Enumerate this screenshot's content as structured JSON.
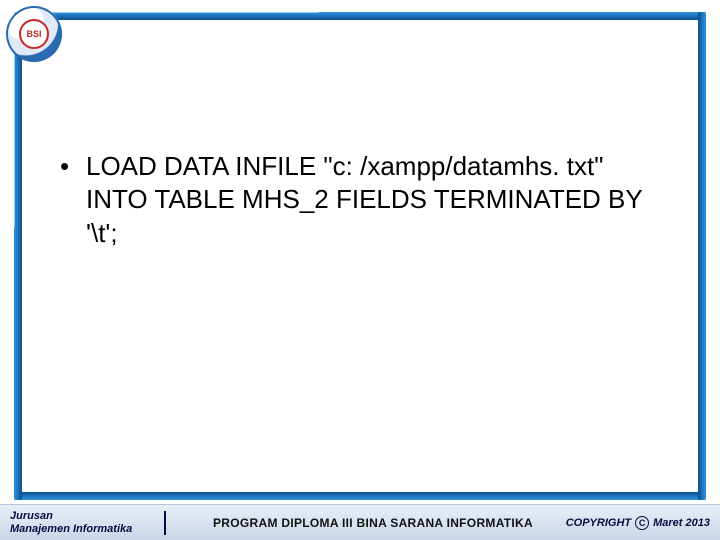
{
  "logo": {
    "text": "BSI"
  },
  "content": {
    "bullet_text": "LOAD DATA INFILE \"c: /xampp/datamhs. txt\" INTO TABLE MHS_2 FIELDS TERMINATED BY '\\t';"
  },
  "footer": {
    "left_line1": "Jurusan",
    "left_line2": "Manajemen Informatika",
    "center": "PROGRAM DIPLOMA III BINA SARANA INFORMATIKA",
    "copyright_label": "COPYRIGHT",
    "copyright_symbol": "C",
    "date": "Maret 2013"
  },
  "colors": {
    "frame_blue": "#0a66b0",
    "footer_bg_top": "#e9eef6",
    "footer_bg_bottom": "#c9d6e8",
    "footer_text": "#0b0b44"
  }
}
